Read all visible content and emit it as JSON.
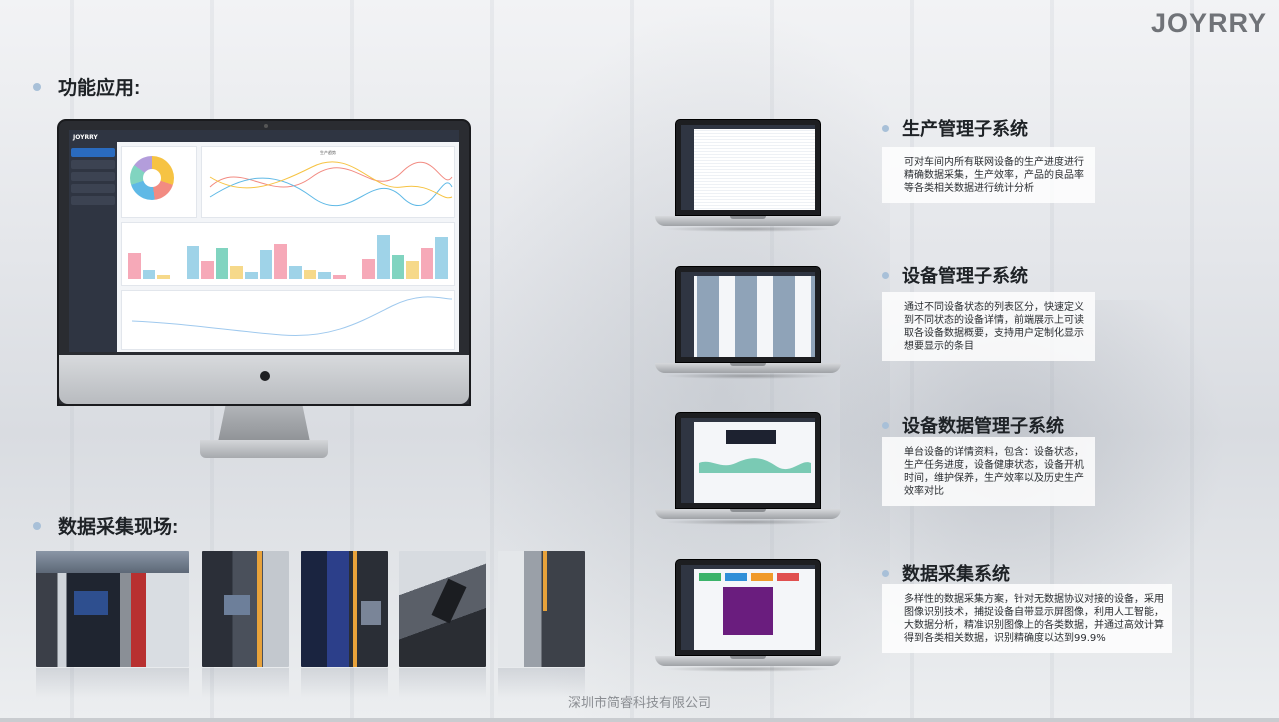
{
  "brand": "JOYRRY",
  "sections": {
    "functions_title": "功能应用:",
    "site_title": "数据采集现场:"
  },
  "systems": [
    {
      "title": "生产管理子系统",
      "desc": "可对车间内所有联网设备的生产进度进行精确数据采集，生产效率，产品的良品率等各类相关数据进行统计分析"
    },
    {
      "title": "设备管理子系统",
      "desc": "通过不同设备状态的列表区分，快速定义到不同状态的设备详情，前端展示上可读取各设备数据概要，支持用户定制化显示想要显示的条目"
    },
    {
      "title": "设备数据管理子系统",
      "desc": "单台设备的详情资料，包含：设备状态，生产任务进度，设备健康状态，设备开机时间，维护保养，生产效率以及历史生产效率对比"
    },
    {
      "title": "数据采集系统",
      "desc": "多样性的数据采集方案，针对无数据协议对接的设备，采用图像识别技术，捕捉设备自带显示屏图像，利用人工智能，大数据分析，精准识别图像上的各类数据，并通过高效计算得到各类相关数据，识别精确度以达到99.9%"
    }
  ],
  "monitor": {
    "logo": "JOYRRY",
    "line_chart_title": "生产趋势"
  },
  "footer": "深圳市简睿科技有限公司",
  "colors": {
    "accent_dot": "#a8c0d8",
    "brand_gray": "#707378"
  }
}
